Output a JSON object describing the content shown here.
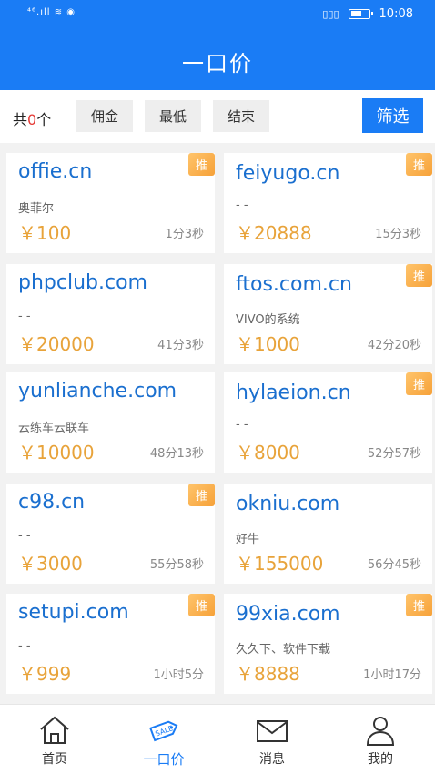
{
  "status": {
    "signal": "⁴⁶.ıll ≋ ◉",
    "vibrate": "▯▯▯",
    "time": "10:08"
  },
  "header": {
    "title": "一口价"
  },
  "filter": {
    "count_prefix": "共",
    "count": "0",
    "count_suffix": "个",
    "chips": [
      "佣金",
      "最低",
      "结束"
    ],
    "filter_button": "筛选"
  },
  "listings": [
    {
      "domain": "offie.cn",
      "desc": "奥菲尔",
      "price": "￥100",
      "time": "1分3秒",
      "badge": "推"
    },
    {
      "domain": "feiyugo.cn",
      "desc": "- -",
      "price": "￥20888",
      "time": "15分3秒",
      "badge": "推"
    },
    {
      "domain": "phpclub.com",
      "desc": "- -",
      "price": "￥20000",
      "time": "41分3秒",
      "badge": ""
    },
    {
      "domain": "ftos.com.cn",
      "desc": "VIVO的系统",
      "price": "￥1000",
      "time": "42分20秒",
      "badge": "推"
    },
    {
      "domain": "yunlianche.com",
      "desc": "云练车云联车",
      "price": "￥10000",
      "time": "48分13秒",
      "badge": ""
    },
    {
      "domain": "hylaeion.cn",
      "desc": "- -",
      "price": "￥8000",
      "time": "52分57秒",
      "badge": "推"
    },
    {
      "domain": "c98.cn",
      "desc": "- -",
      "price": "￥3000",
      "time": "55分58秒",
      "badge": "推"
    },
    {
      "domain": "okniu.com",
      "desc": "好牛",
      "price": "￥155000",
      "time": "56分45秒",
      "badge": ""
    },
    {
      "domain": "setupi.com",
      "desc": "- -",
      "price": "￥999",
      "time": "1小时5分",
      "badge": "推"
    },
    {
      "domain": "99xia.com",
      "desc": "久久下、软件下载",
      "price": "￥8888",
      "time": "1小时17分",
      "badge": "推"
    }
  ],
  "tabs": [
    {
      "label": "首页",
      "icon": "home-icon"
    },
    {
      "label": "一口价",
      "icon": "sale-tag-icon"
    },
    {
      "label": "消息",
      "icon": "mail-icon"
    },
    {
      "label": "我的",
      "icon": "user-icon"
    }
  ],
  "colors": {
    "primary": "#1a7cf5",
    "price": "#e8a33a",
    "domain": "#1a6fcf",
    "badge": "#f6a138"
  }
}
